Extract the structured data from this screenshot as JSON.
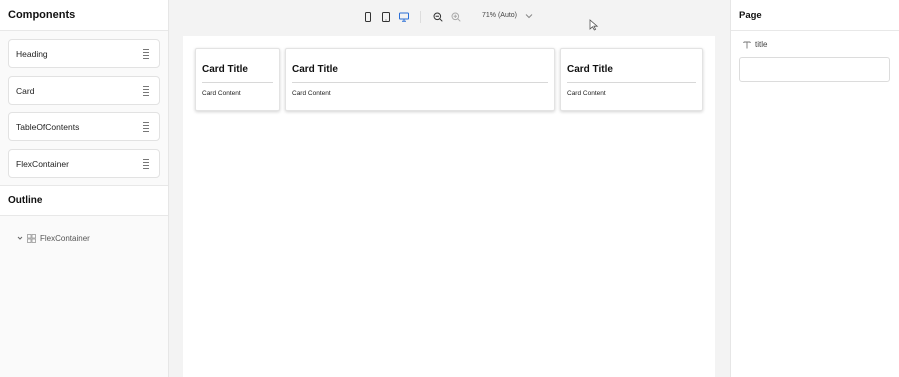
{
  "left_panel": {
    "components_title": "Components",
    "components": [
      {
        "label": "Heading"
      },
      {
        "label": "Card"
      },
      {
        "label": "TableOfContents"
      },
      {
        "label": "FlexContainer"
      }
    ],
    "outline_title": "Outline",
    "outline_items": [
      {
        "label": "FlexContainer"
      }
    ]
  },
  "toolbar": {
    "viewports": [
      "mobile-icon",
      "tablet-icon",
      "desktop-icon"
    ],
    "active_viewport": "desktop",
    "zoom_label": "71% (Auto)"
  },
  "canvas": {
    "cards": [
      {
        "title": "Card Title",
        "content": "Card Content"
      },
      {
        "title": "Card Title",
        "content": "Card Content"
      },
      {
        "title": "Card Title",
        "content": "Card Content"
      }
    ]
  },
  "right_panel": {
    "title": "Page",
    "field_label": "title",
    "field_value": ""
  },
  "colors": {
    "accent": "#2b6fd6",
    "panel_bg": "#fafafa",
    "canvas_bg": "#f3f3f3"
  }
}
